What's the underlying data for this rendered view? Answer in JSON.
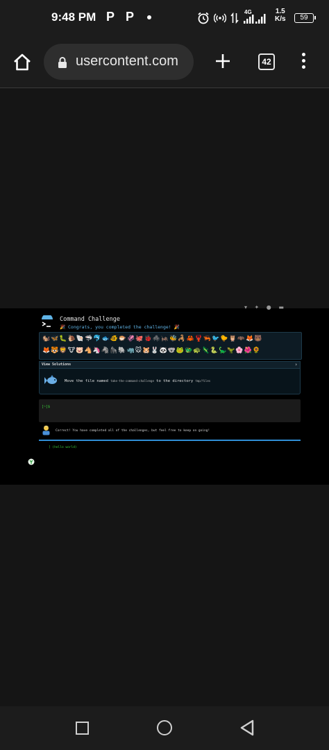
{
  "status_bar": {
    "time": "9:48 PM",
    "notif1": "P",
    "notif2": "P",
    "network": "4G",
    "speed_value": "1.5",
    "speed_unit": "K/s",
    "battery": "59"
  },
  "toolbar": {
    "url": "usercontent.com",
    "tab_count": "42"
  },
  "page": {
    "title": "Command Challenge",
    "congrats": "🎉 Congrats, you completed the challenge! 🎉",
    "emoji_row1": "🐿️🦋🐛🐌🐚🦈🐬🐟🐠🐡🦑🐙🐞🕷️🦗🐝🦂🦀🦞🦐🐦🐤🦉🦇🦊🐻",
    "emoji_row2": "🦊🐯🦁🐮🐷🐴🦄🦓🦍🐘🦏🐭🐹🐰🐼🐨🐸🐲🐢🦎🐍🦕🦖🌸🌺🌻",
    "solutions_label": "View Solutions",
    "solutions_chevron": "›",
    "task_prefix": "Move the file named ",
    "task_file": "take-the-command-challenge",
    "task_mid": " to the directory ",
    "task_dir": "tmp/files",
    "prompt": "[~]$",
    "correct_msg": "Correct! You have completed all of the challenges, but feel free to keep on going!",
    "progress": 1.0,
    "hello": "[ (hello world)"
  },
  "colors": {
    "page_bg": "#000000",
    "accent_blue": "#5fb3e6",
    "terminal_green": "#3ad13a",
    "browser_bg": "#1c1c1c"
  },
  "icons": {
    "home": "home-icon",
    "lock": "lock-icon",
    "plus": "plus-icon",
    "menu": "more-vert-icon",
    "nav_recent": "square-icon",
    "nav_home": "circle-icon",
    "nav_back": "triangle-back-icon"
  }
}
